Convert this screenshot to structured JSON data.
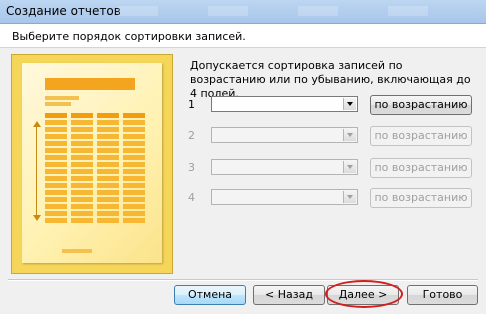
{
  "window": {
    "title": "Создание отчетов"
  },
  "header": {
    "prompt": "Выберите порядок сортировки записей."
  },
  "description": "Допускается сортировка записей по возрастанию или по убыванию, включающая до 4 полей.",
  "sort_rows": [
    {
      "number": "1",
      "field_value": "",
      "order_label": "по возрастанию",
      "enabled": true
    },
    {
      "number": "2",
      "field_value": "",
      "order_label": "по возрастанию",
      "enabled": false
    },
    {
      "number": "3",
      "field_value": "",
      "order_label": "по возрастанию",
      "enabled": false
    },
    {
      "number": "4",
      "field_value": "",
      "order_label": "по возрастанию",
      "enabled": false
    }
  ],
  "buttons": {
    "cancel": "Отмена",
    "back": "< Назад",
    "next": "Далее >",
    "finish": "Готово"
  },
  "colors": {
    "highlight": "#d21e1e"
  }
}
